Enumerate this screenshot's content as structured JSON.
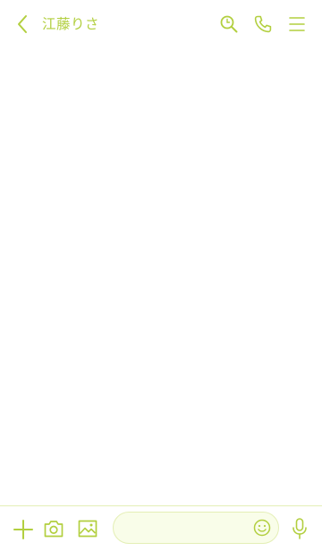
{
  "header": {
    "title": "江藤りさ",
    "icons": {
      "back": "back-icon",
      "search": "search-icon",
      "call": "phone-icon",
      "menu": "menu-icon"
    }
  },
  "footer": {
    "input": {
      "value": "",
      "placeholder": ""
    },
    "icons": {
      "add": "plus-icon",
      "camera": "camera-icon",
      "gallery": "image-icon",
      "emoji": "emoji-icon",
      "voice": "mic-icon"
    }
  },
  "colors": {
    "accent": "#b2cf3f",
    "input_background": "#f9fde9",
    "divider": "#e4efb6",
    "background": "#ffffff"
  }
}
